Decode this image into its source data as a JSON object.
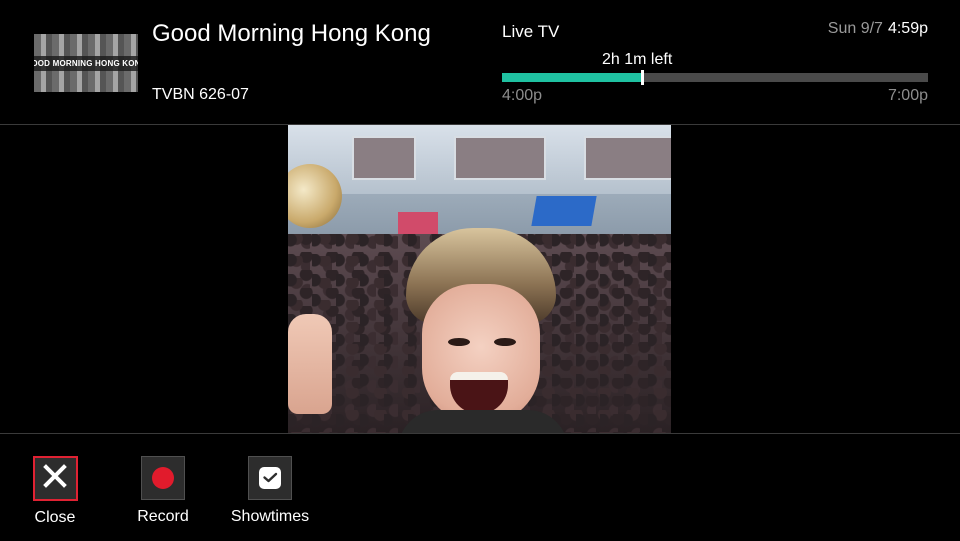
{
  "header": {
    "thumbnail_text": "GOOD MORNING HONG KONG",
    "program_title": "Good Morning Hong Kong",
    "channel": "TVBN 626-07",
    "source": "Live TV",
    "date": "Sun 9/7",
    "time": "4:59p",
    "time_left": "2h 1m left",
    "start_time": "4:00p",
    "end_time": "7:00p",
    "progress_fraction": 0.328,
    "progress_color": "#1fc1a1"
  },
  "actions": [
    {
      "label": "Close",
      "icon": "close-icon"
    },
    {
      "label": "Record",
      "icon": "record-icon"
    },
    {
      "label": "Showtimes",
      "icon": "clock-icon"
    }
  ],
  "colors": {
    "focus_border": "#e02233",
    "record_red": "#e11b2c",
    "accent_teal": "#1fc1a1"
  }
}
